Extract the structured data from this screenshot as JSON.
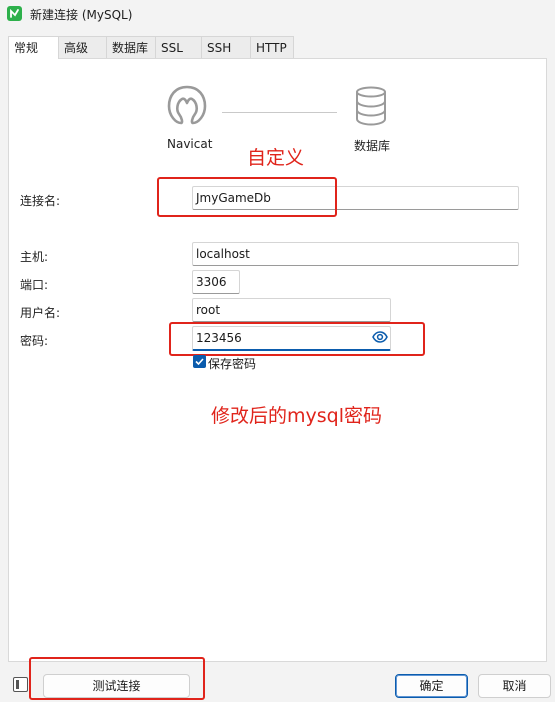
{
  "window": {
    "title": "新建连接 (MySQL)"
  },
  "tabs": [
    {
      "label": "常规",
      "active": true
    },
    {
      "label": "高级"
    },
    {
      "label": "数据库"
    },
    {
      "label": "SSL"
    },
    {
      "label": "SSH"
    },
    {
      "label": "HTTP"
    }
  ],
  "diagram": {
    "left_label": "Navicat",
    "right_label": "数据库",
    "left_icon": "navicat-seal-icon",
    "right_icon": "database-icon"
  },
  "form": {
    "connection_name": {
      "label": "连接名:",
      "value": "JmyGameDb"
    },
    "host": {
      "label": "主机:",
      "value": "localhost"
    },
    "port": {
      "label": "端口:",
      "value": "3306"
    },
    "username": {
      "label": "用户名:",
      "value": "root"
    },
    "password": {
      "label": "密码:",
      "value": "123456",
      "reveal_icon": "eye-icon"
    },
    "save_password": {
      "label": "保存密码",
      "checked": true
    }
  },
  "annotations": {
    "custom_note": "自定义",
    "password_note": "修改后的mysql密码",
    "color": "#e0241b"
  },
  "footer": {
    "test_button": "测试连接",
    "ok_button": "确定",
    "cancel_button": "取消"
  },
  "colors": {
    "accent": "#0b5cad",
    "app_icon": "#2db04b"
  }
}
